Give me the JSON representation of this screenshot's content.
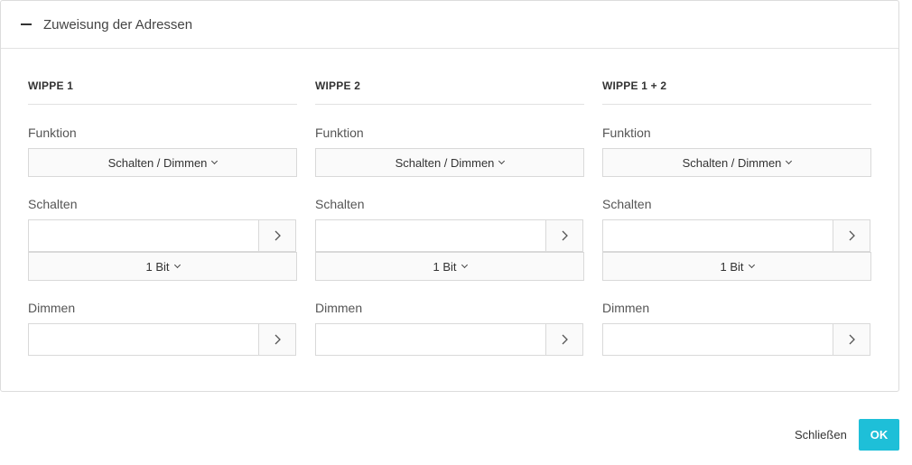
{
  "panel": {
    "title": "Zuweisung der Adressen"
  },
  "columns": [
    {
      "title": "WIPPE 1",
      "funktion_label": "Funktion",
      "funktion_value": "Schalten / Dimmen",
      "schalten_label": "Schalten",
      "schalten_value": "",
      "bit_value": "1 Bit",
      "dimmen_label": "Dimmen",
      "dimmen_value": ""
    },
    {
      "title": "WIPPE 2",
      "funktion_label": "Funktion",
      "funktion_value": "Schalten / Dimmen",
      "schalten_label": "Schalten",
      "schalten_value": "",
      "bit_value": "1 Bit",
      "dimmen_label": "Dimmen",
      "dimmen_value": ""
    },
    {
      "title": "WIPPE 1 + 2",
      "funktion_label": "Funktion",
      "funktion_value": "Schalten / Dimmen",
      "schalten_label": "Schalten",
      "schalten_value": "",
      "bit_value": "1 Bit",
      "dimmen_label": "Dimmen",
      "dimmen_value": ""
    }
  ],
  "footer": {
    "close_label": "Schließen",
    "ok_label": "OK"
  },
  "colors": {
    "accent": "#1ebfd8",
    "border": "#d9d9d9"
  },
  "icons": {
    "collapse": "minus-icon",
    "dropdown": "chevron-down-icon",
    "select": "chevron-right-icon"
  }
}
